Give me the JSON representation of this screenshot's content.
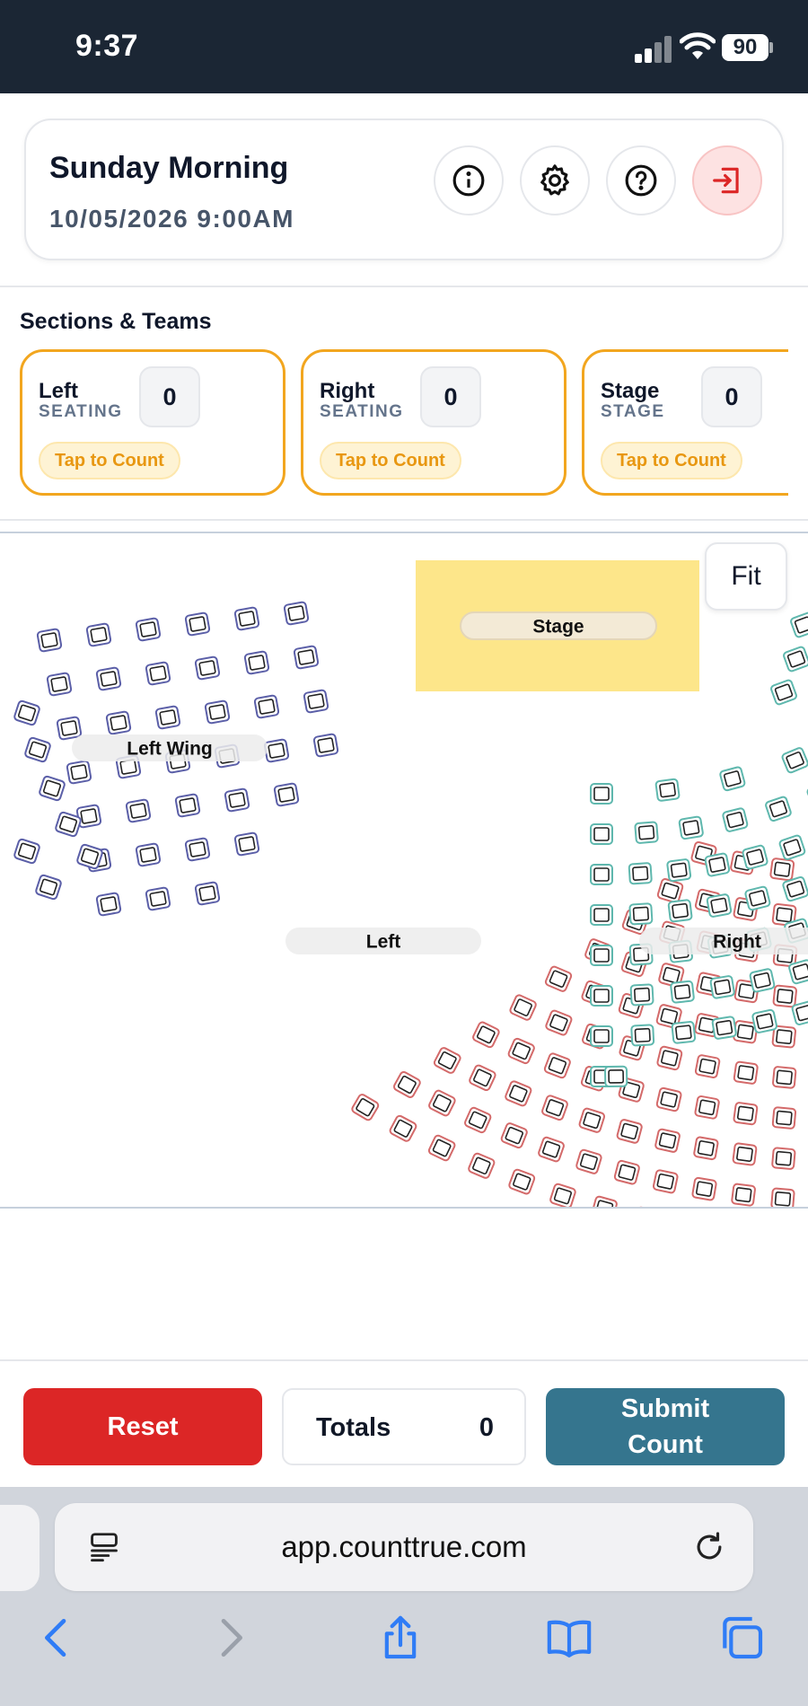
{
  "status_bar": {
    "time": "9:37",
    "battery": "90"
  },
  "header": {
    "title": "Sunday Morning",
    "datetime": "10/05/2026 9:00AM",
    "icons": [
      "info-icon",
      "gear-icon",
      "help-icon",
      "logout-icon"
    ]
  },
  "sections": {
    "title": "Sections & Teams",
    "cards": [
      {
        "name": "Left",
        "type": "SEATING",
        "count": "0",
        "action": "Tap to Count"
      },
      {
        "name": "Right",
        "type": "SEATING",
        "count": "0",
        "action": "Tap to Count"
      },
      {
        "name": "Stage",
        "type": "STAGE",
        "count": "0",
        "action": "Tap to Count"
      }
    ]
  },
  "map": {
    "fit_label": "Fit",
    "stage_label": "Stage",
    "labels": {
      "left_wing": "Left Wing",
      "left": "Left",
      "right": "Right"
    },
    "colors": {
      "left_wing": "#5b5fa8",
      "left": "#d46a6a",
      "right": "#5fb8ae",
      "stage": "#fde68a"
    }
  },
  "actions": {
    "reset": "Reset",
    "totals_label": "Totals",
    "totals_value": "0",
    "submit": "Submit Count"
  },
  "colors": {
    "accent": "#f2a61f",
    "danger": "#dc2626",
    "submit": "#35758e",
    "ios_blue": "#2f7cf6"
  },
  "browser": {
    "url": "app.counttrue.com"
  }
}
